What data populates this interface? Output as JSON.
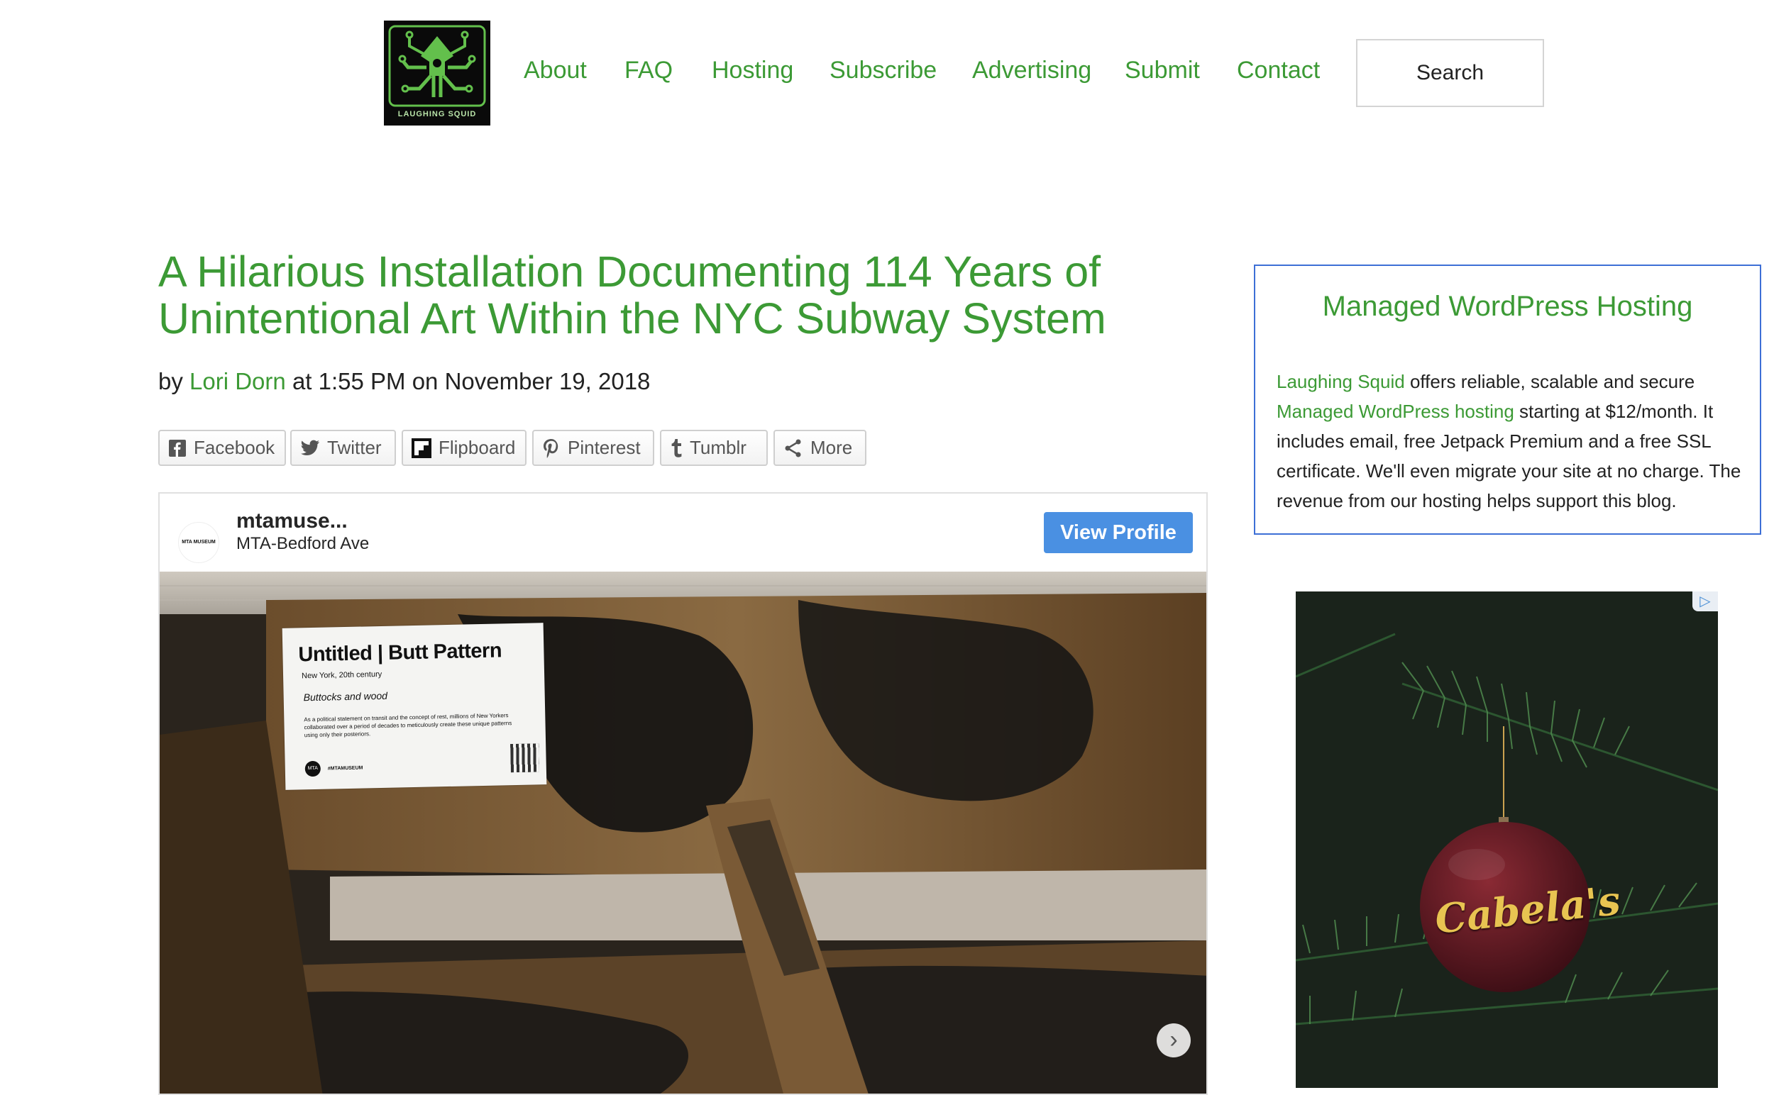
{
  "site": {
    "logo_text": "LAUGHING SQUID",
    "nav": [
      "About",
      "FAQ",
      "Hosting",
      "Subscribe",
      "Advertising",
      "Submit",
      "Contact"
    ],
    "search_label": "Search"
  },
  "article": {
    "title": "A Hilarious Installation Documenting 114 Years of Unintentional Art Within the NYC Subway System",
    "byline_prefix": "by",
    "author": "Lori Dorn",
    "byline_time": "at 1:55 PM on November 19, 2018",
    "share_buttons": [
      "Facebook",
      "Twitter",
      "Flipboard",
      "Pinterest",
      "Tumblr",
      "More"
    ]
  },
  "embed": {
    "avatar_text": "MTA MUSEUM",
    "username": "mtamuse...",
    "location": "MTA-Bedford Ave",
    "view_profile": "View Profile",
    "placard": {
      "title": "Untitled | Butt Pattern",
      "subtitle": "New York, 20th century",
      "medium": "Buttocks and wood",
      "description": "As a political statement on transit and the concept of rest, millions of New Yorkers collaborated over a period of decades to meticulously create these unique patterns using only their posteriors.",
      "tag": "#MTAMUSEUM",
      "logo": "MTA"
    }
  },
  "sidebar": {
    "hosting_title": "Managed WordPress Hosting",
    "hosting_link1": "Laughing Squid",
    "hosting_text1": " offers reliable, scalable and secure ",
    "hosting_link2": "Managed WordPress hosting",
    "hosting_text2": " starting at $12/month. It includes email, free Jetpack Premium and a free SSL certificate. We'll even migrate your site at no charge. The revenue from our hosting helps support this blog."
  },
  "ad": {
    "brand": "Cabela's",
    "badge": "▷"
  },
  "colors": {
    "link_green": "#3c9a35",
    "box_border_blue": "#3d6fd6",
    "view_profile_blue": "#4a90e2"
  }
}
